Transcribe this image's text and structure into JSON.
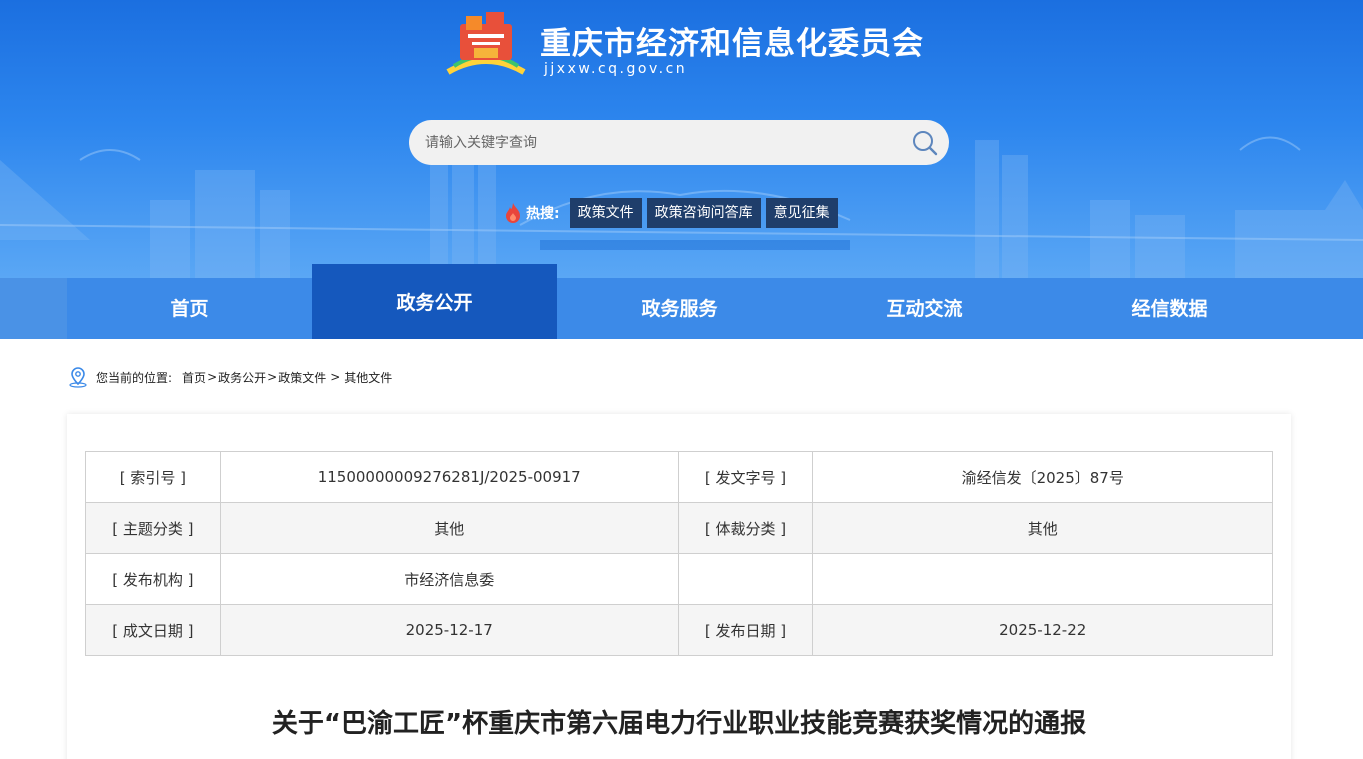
{
  "site": {
    "title": "重庆市经济和信息化委员会",
    "domain": "jjxxw.cq.gov.cn"
  },
  "search": {
    "placeholder": "请输入关键字查询"
  },
  "hot": {
    "label": "热搜:",
    "tags": [
      "政策文件",
      "政策咨询问答库",
      "意见征集"
    ]
  },
  "nav": {
    "items": [
      "首页",
      "政务公开",
      "政务服务",
      "互动交流",
      "经信数据"
    ],
    "active": "政务公开"
  },
  "breadcrumb": {
    "label": "您当前的位置:",
    "items": [
      "首页",
      "政务公开",
      "政策文件",
      "其他文件"
    ]
  },
  "meta_table": {
    "rows": [
      [
        "[ 索引号 ]",
        "11500000009276281J/2025-00917",
        "[ 发文字号 ]",
        "渝经信发〔2025〕87号"
      ],
      [
        "[ 主题分类 ]",
        "其他",
        "[ 体裁分类 ]",
        "其他"
      ],
      [
        "[ 发布机构 ]",
        "市经济信息委",
        "",
        ""
      ],
      [
        "[ 成文日期 ]",
        "2025-12-17",
        "[ 发布日期 ]",
        "2025-12-22"
      ]
    ]
  },
  "document": {
    "title": "关于“巴渝工匠”杯重庆市第六届电力行业职业技能竞赛获奖情况的通报"
  },
  "colors": {
    "banner_top": "#1b6fe0",
    "nav_bg": "#3c8ae8",
    "nav_active": "#1558bd",
    "hot_tag_bg": "#1f3e6b"
  }
}
